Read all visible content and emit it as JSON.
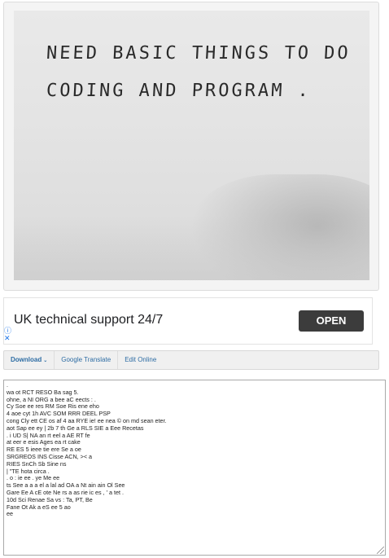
{
  "photo": {
    "line1": "NEED BASIC THINGS TO DO",
    "line2": "CODING AND PROGRAM ."
  },
  "ad": {
    "headline": "UK technical support 24/7",
    "button_label": "OPEN",
    "info_icon": "info-icon",
    "close_icon": "close-icon"
  },
  "toolbar": {
    "download_label": "Download",
    "translate_label": "Google Translate",
    "edit_label": "Edit Online"
  },
  "ocr_lines": [
    ".",
    "wa ot RCT RESO Ba sag 5.",
    "ohne, a NI ORG a bee aC eects : .",
    "Cy Soe ee res RM Soe Ris ene eho",
    "4 aoe cyt 1h AVC SOM RRR DEEL PSP",
    "cong Cly ett CE os af 4 aa RYE ie! ee nea © on md sean eter.",
    "aot Sap ee ey | 2b 7 th Ge a RLS SIE a Eee Recetas",
    ". i UD S| NA an rt eel a AE RT fe",
    "at eer e esis Ages ea rt cake",
    "RE ES 5 ieee tie ere Se a oe",
    "SRGREOS INS Cisse ACN, >< a",
    "RIES SnCh Sb Sine ns",
    "| \"TE hota circa .",
    ". o : ie ee . ye Me ee",
    "ts See a a a el a lal ad OA a Nt ain ain Ol See",
    "Gare Ee A cE ote Ne rs a as rie ic es , ' a tet .",
    "10d Sci Renae Sa vs : Ta, PT, Be",
    "Fane Ot Ak a eS ee 5 ao",
    "ee"
  ]
}
